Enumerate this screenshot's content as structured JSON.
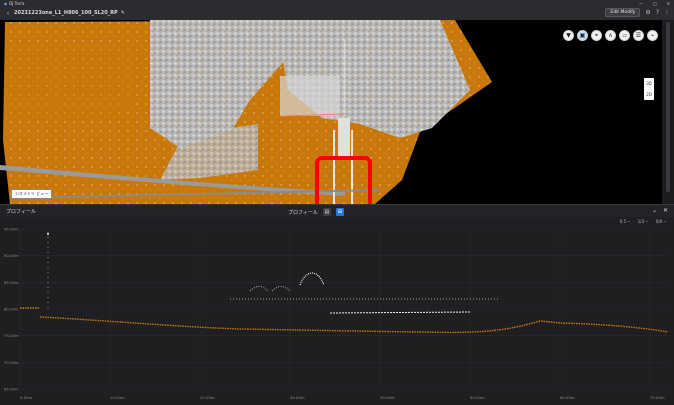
{
  "titlebar": {
    "app_name": "DJ Terra"
  },
  "toolbar": {
    "file_name": "20231223one_L1_H806_100_SL20_RP",
    "edit_modify_label": "Edit Modify"
  },
  "map": {
    "label": "ジオメトリ ビュー",
    "viewcube": {
      "top": "3D",
      "bottom": "2D"
    }
  },
  "profile_panel": {
    "title": "プロフィール",
    "center_title": "プロフィール",
    "settings": [
      "0.5 ─",
      "1/3 ─",
      "0/0 ─"
    ]
  },
  "profile_chart": {
    "y_ticks": [
      "95.00m",
      "90.00m",
      "85.00m",
      "80.00m",
      "75.00m",
      "70.00m",
      "65.00m"
    ],
    "x_ticks": [
      "0.00m",
      "10.00m",
      "20.00m",
      "30.00m",
      "40.00m",
      "50.00m",
      "60.00m",
      "70.00m"
    ]
  },
  "colors": {
    "accent_blue": "#1f7ae0",
    "highlight_red": "#ff0000",
    "terrain_orange": "#c8780a",
    "vegetation_gray": "#bdbdbd"
  }
}
